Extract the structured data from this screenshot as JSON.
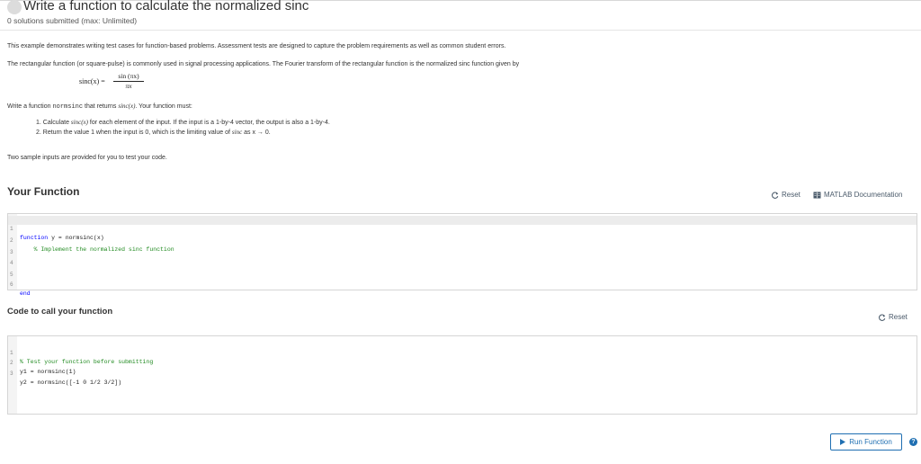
{
  "header": {
    "title": "Write a function to calculate the normalized sinc",
    "subtitle": "0 solutions submitted (max: Unlimited)"
  },
  "description": {
    "p1": "This example demonstrates writing test cases for function-based problems. Assessment tests are designed to capture the problem requirements as well as common student errors.",
    "p2": "The rectangular function (or square-pulse) is commonly used in signal processing applications. The Fourier transform of the rectangular function is the normalized sinc function given by",
    "formula_lhs": "sinc(x) =",
    "formula_num": "sin (πx)",
    "formula_den": "πx",
    "p3_a": "Write a function ",
    "p3_fn": "normsinc",
    "p3_b": " that returns ",
    "p3_math": "sinc(x)",
    "p3_c": ". Your function must:",
    "list": [
      {
        "a": "1.  Calculate ",
        "m": "sinc(x)",
        "b": " for each element of the input. If the input is a 1-by-4  vector, the output is also a 1-by-4."
      },
      {
        "a": "2.  Return the value 1 when the input is 0, which is the limiting value of ",
        "m": "sinc",
        "b": " as x → 0."
      }
    ],
    "p4": "Two sample inputs are provided for you to test your code."
  },
  "your_function": {
    "title": "Your Function",
    "reset_label": "Reset",
    "docs_label": "MATLAB Documentation",
    "lines": [
      {
        "n": "1",
        "kw": "function",
        "t": " y = normsinc(x)",
        "c": ""
      },
      {
        "n": "2",
        "kw": "",
        "t": "    ",
        "c": "% Implement the normalized sinc function"
      },
      {
        "n": "3",
        "kw": "",
        "t": "",
        "c": ""
      },
      {
        "n": "4",
        "kw": "",
        "t": "",
        "c": ""
      },
      {
        "n": "5",
        "kw": "",
        "t": "",
        "c": ""
      },
      {
        "n": "6",
        "kw": "end",
        "t": "",
        "c": ""
      }
    ]
  },
  "call_function": {
    "title": "Code to call your function",
    "reset_label": "Reset",
    "lines": [
      {
        "n": "1",
        "t": "",
        "c": "% Test your function before submitting"
      },
      {
        "n": "2",
        "t": "y1 = normsinc(1)",
        "c": ""
      },
      {
        "n": "3",
        "t": "y2 = normsinc([-1 0 1/2 3/2])",
        "c": ""
      }
    ]
  },
  "footer": {
    "run_label": "Run Function",
    "help_glyph": "?"
  },
  "colors": {
    "accent": "#1f6fb2",
    "keyword": "#0000ff",
    "comment": "#228b22"
  }
}
